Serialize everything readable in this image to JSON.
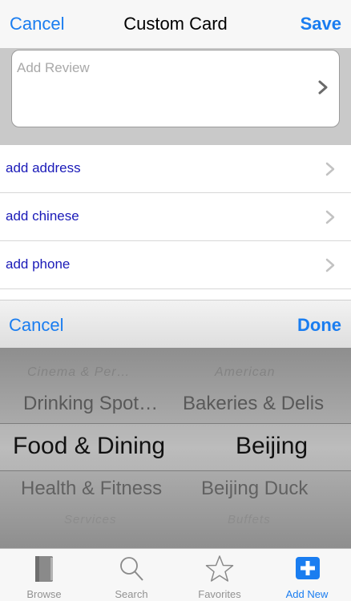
{
  "navbar": {
    "cancel": "Cancel",
    "title": "Custom Card",
    "save": "Save"
  },
  "review": {
    "placeholder": "Add Review"
  },
  "list": {
    "items": [
      "add address",
      "add chinese",
      "add phone"
    ]
  },
  "picker_bar": {
    "cancel": "Cancel",
    "done": "Done"
  },
  "picker": {
    "left_column": [
      "Cinema & Per…",
      "Drinking Spot…",
      "Food & Dining",
      "Health & Fitness",
      "Services"
    ],
    "right_column": [
      "American",
      "Bakeries & Delis",
      "Beijing",
      "Beijing Duck",
      "Buffets"
    ],
    "selected_left": "Food & Dining",
    "selected_right": "Beijing"
  },
  "tabbar": {
    "tabs": [
      {
        "label": "Browse",
        "icon": "book-icon"
      },
      {
        "label": "Search",
        "icon": "magnifier-icon"
      },
      {
        "label": "Favorites",
        "icon": "star-icon"
      },
      {
        "label": "Add New",
        "icon": "plus-icon"
      }
    ],
    "active_tab": "Add New"
  },
  "colors": {
    "accent": "#1a7df0",
    "link": "#1a1ab8",
    "inactive": "#929292"
  }
}
